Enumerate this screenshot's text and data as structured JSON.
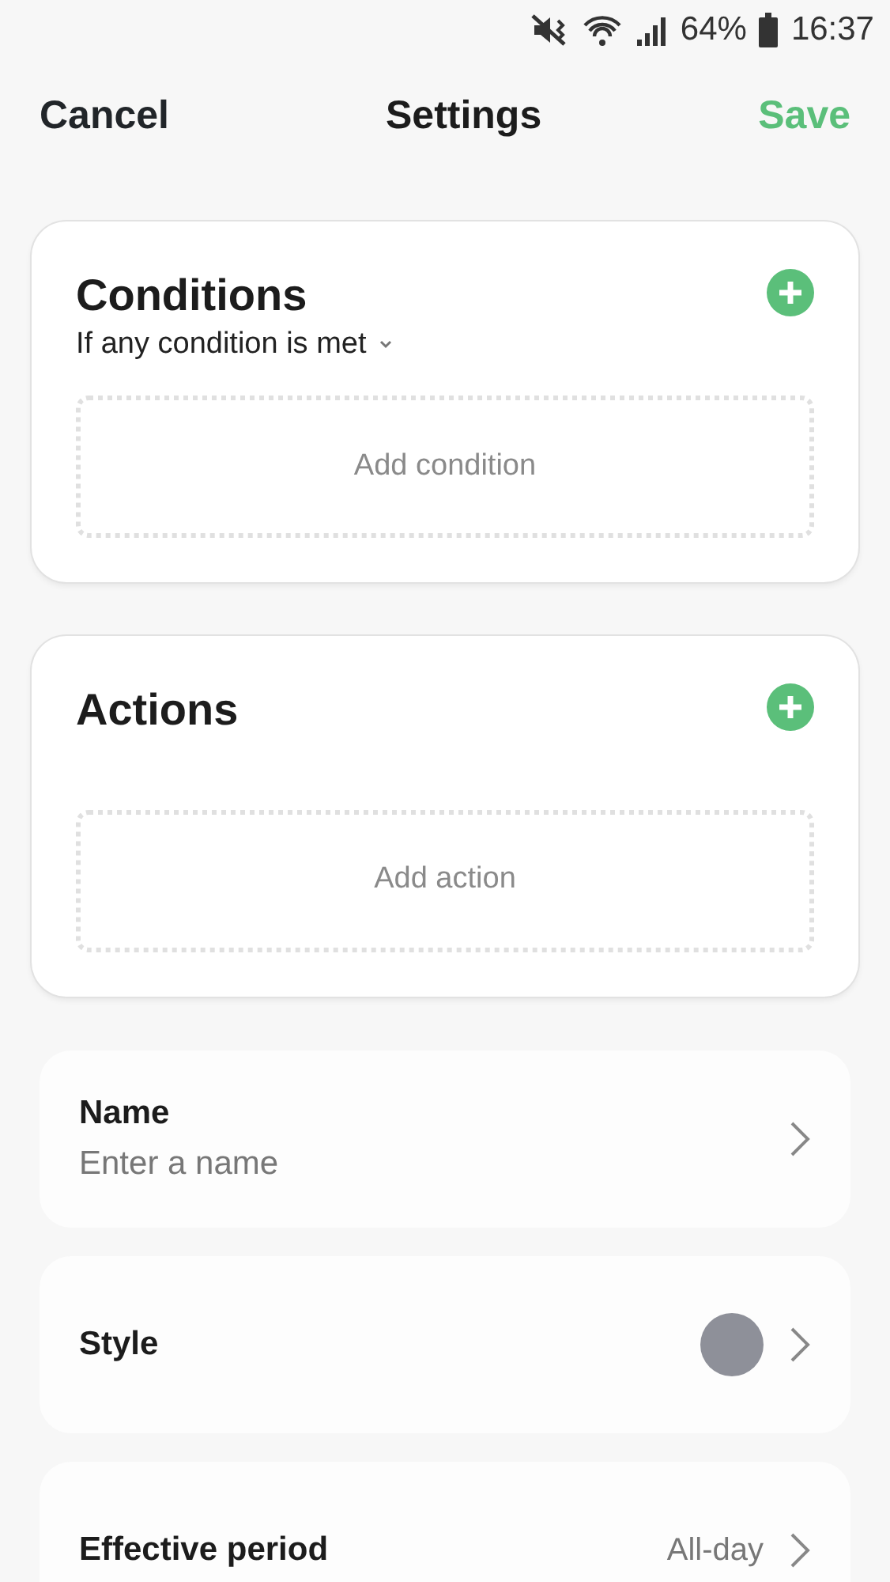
{
  "status_bar": {
    "battery": "64%",
    "time": "16:37"
  },
  "header": {
    "cancel": "Cancel",
    "title": "Settings",
    "save": "Save"
  },
  "sections": [
    {
      "title": "Conditions",
      "subtitle": "If any condition is met",
      "placeholder": "Add condition"
    },
    {
      "title": "Actions",
      "placeholder": "Add action"
    }
  ],
  "rows": [
    {
      "kind": "field",
      "label": "Name",
      "placeholder": "Enter a name"
    },
    {
      "kind": "color",
      "label": "Style",
      "color": "#8e9099"
    },
    {
      "kind": "value",
      "label": "Effective period",
      "value": "All-day"
    }
  ]
}
